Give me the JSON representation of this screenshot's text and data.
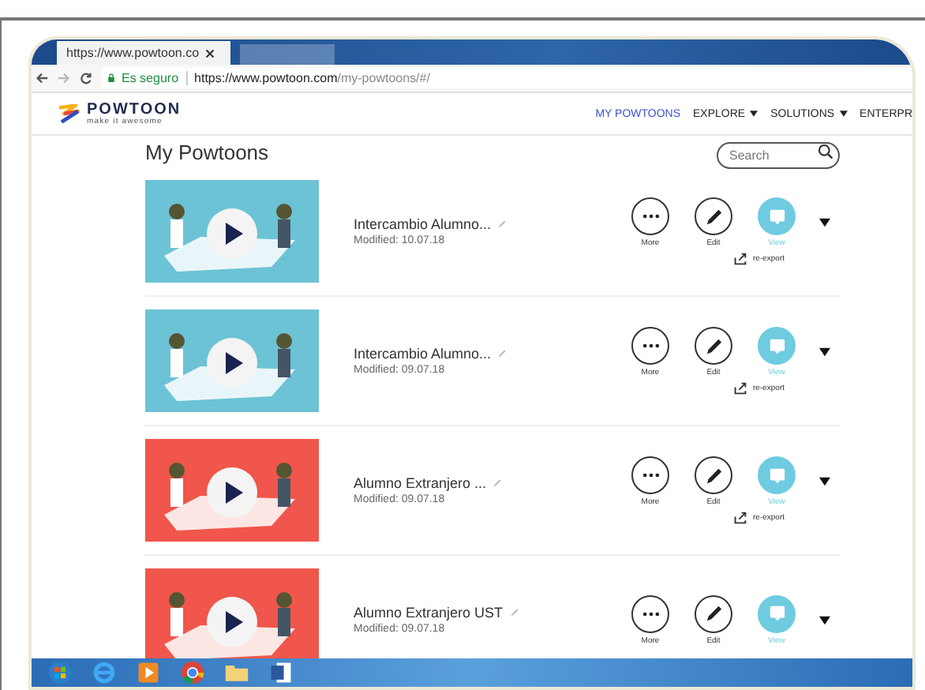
{
  "browser": {
    "tab_title": "https://www.powtoon.co",
    "secure_label": "Es seguro",
    "url_host": "https://www.powtoon.com",
    "url_path": "/my-powtoons/#/"
  },
  "header": {
    "logo": "POWTOON",
    "tagline": "make it awesome",
    "nav": [
      {
        "label": "MY POWTOONS",
        "selected": true,
        "dropdown": false
      },
      {
        "label": "EXPLORE",
        "selected": false,
        "dropdown": true
      },
      {
        "label": "SOLUTIONS",
        "selected": false,
        "dropdown": true
      },
      {
        "label": "ENTERPR",
        "selected": false,
        "dropdown": false
      }
    ]
  },
  "page_title": "My Powtoons",
  "search": {
    "placeholder": "Search"
  },
  "powtoons": [
    {
      "title": "Intercambio Alumno...",
      "modified": "Modified: 10.07.18",
      "color": "#6cc3d5",
      "actions": [
        {
          "kind": "more",
          "label": "More"
        },
        {
          "kind": "edit",
          "label": "Edit"
        },
        {
          "kind": "view",
          "label": "View"
        }
      ],
      "reexport": "re-export"
    },
    {
      "title": "Intercambio Alumno...",
      "modified": "Modified: 09.07.18",
      "color": "#6cc3d5",
      "actions": [
        {
          "kind": "more",
          "label": "More"
        },
        {
          "kind": "edit",
          "label": "Edit"
        },
        {
          "kind": "view",
          "label": "View"
        }
      ],
      "reexport": "re-export"
    },
    {
      "title": "Alumno Extranjero ...",
      "modified": "Modified: 09.07.18",
      "color": "#f0564b",
      "actions": [
        {
          "kind": "more",
          "label": "More"
        },
        {
          "kind": "edit",
          "label": "Edit"
        },
        {
          "kind": "view",
          "label": "View"
        }
      ],
      "reexport": "re-export"
    },
    {
      "title": "Alumno Extranjero UST",
      "modified": "Modified: 09.07.18",
      "color": "#f0564b",
      "actions": [
        {
          "kind": "more",
          "label": "More"
        },
        {
          "kind": "edit",
          "label": "Edit"
        },
        {
          "kind": "view",
          "label": "View"
        }
      ]
    }
  ],
  "taskbar": [
    {
      "kind": "start"
    },
    {
      "kind": "ie"
    },
    {
      "kind": "media"
    },
    {
      "kind": "chrome"
    },
    {
      "kind": "folder"
    },
    {
      "kind": "word"
    }
  ]
}
